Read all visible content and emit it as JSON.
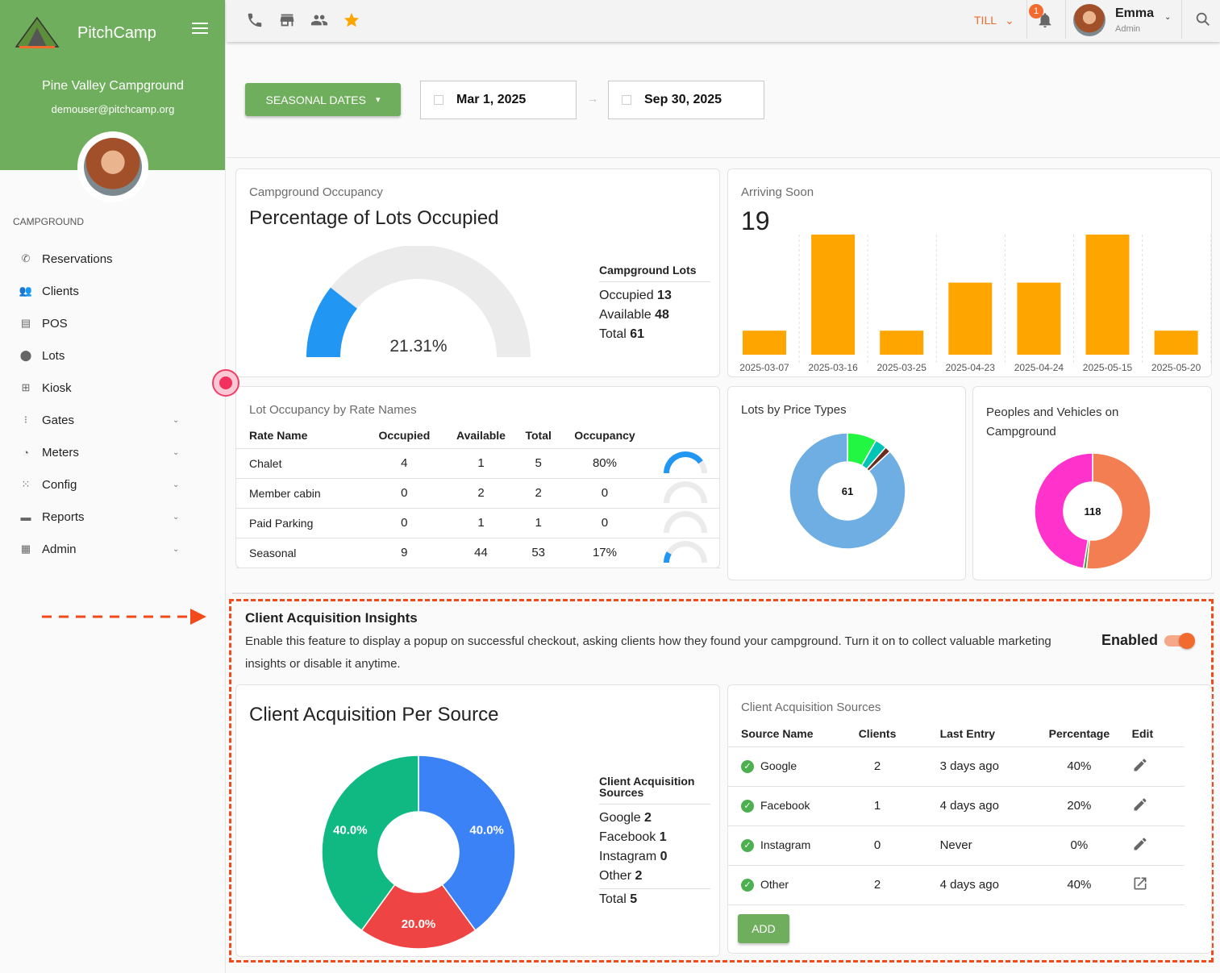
{
  "sidebar": {
    "brand": "PitchCamp",
    "campground_name": "Pine Valley Campground",
    "email": "demouser@pitchcamp.org",
    "section_label": "CAMPGROUND",
    "items": [
      {
        "label": "Reservations",
        "icon": "phone-icon",
        "expandable": false
      },
      {
        "label": "Clients",
        "icon": "people-icon",
        "expandable": false
      },
      {
        "label": "POS",
        "icon": "store-icon",
        "expandable": false
      },
      {
        "label": "Lots",
        "icon": "location-pin-icon",
        "expandable": false
      },
      {
        "label": "Kiosk",
        "icon": "kiosk-screen-icon",
        "expandable": false
      },
      {
        "label": "Gates",
        "icon": "traffic-light-icon",
        "expandable": true
      },
      {
        "label": "Meters",
        "icon": "meter-icon",
        "expandable": true
      },
      {
        "label": "Config",
        "icon": "grid-icon",
        "expandable": true
      },
      {
        "label": "Reports",
        "icon": "printer-icon",
        "expandable": true
      },
      {
        "label": "Admin",
        "icon": "dashboard-icon",
        "expandable": true
      }
    ]
  },
  "topbar": {
    "quick_icons": [
      "phone-icon",
      "store-icon",
      "people-icon",
      "star-icon"
    ],
    "till_label": "TILL",
    "notification_count": "1",
    "user_name": "Emma",
    "user_role": "Admin"
  },
  "filters": {
    "seasonal_label": "SEASONAL DATES",
    "start_date": "Mar 1, 2025",
    "end_date": "Sep 30, 2025",
    "arrow": "→"
  },
  "occupancy": {
    "subtitle": "Campground Occupancy",
    "title": "Percentage of Lots Occupied",
    "percent_label": "21.31%",
    "percent_value": 21.31,
    "legend_title": "Campground Lots",
    "rows": [
      {
        "label": "Occupied",
        "value": "13"
      },
      {
        "label": "Available",
        "value": "48"
      },
      {
        "label": "Total",
        "value": "61"
      }
    ],
    "colors": {
      "fill": "#2196f3",
      "track": "#ebebeb"
    }
  },
  "arriving": {
    "subtitle": "Arriving Soon",
    "total": "19"
  },
  "rate_table": {
    "subtitle": "Lot Occupancy by Rate Names",
    "headers": [
      "Rate Name",
      "Occupied",
      "Available",
      "Total",
      "Occupancy"
    ],
    "rows": [
      {
        "name": "Chalet",
        "occupied": "4",
        "available": "1",
        "total": "5",
        "occupancy": "80%",
        "fraction": 0.8
      },
      {
        "name": "Member cabin",
        "occupied": "0",
        "available": "2",
        "total": "2",
        "occupancy": "0",
        "fraction": 0
      },
      {
        "name": "Paid Parking",
        "occupied": "0",
        "available": "1",
        "total": "1",
        "occupancy": "0",
        "fraction": 0
      },
      {
        "name": "Seasonal",
        "occupied": "9",
        "available": "44",
        "total": "53",
        "occupancy": "17%",
        "fraction": 0.17
      }
    ]
  },
  "price_types": {
    "title": "Lots by Price Types",
    "center_label": "61"
  },
  "people_vehicles": {
    "title": "Peoples and Vehicles on Campground",
    "center_label": "118"
  },
  "insights": {
    "title": "Client Acquisition Insights",
    "description": "Enable this feature to display a popup on successful checkout, asking clients how they found your campground. Turn it on to collect valuable marketing insights or disable it anytime.",
    "enabled_label": "Enabled",
    "enabled": true
  },
  "acq_chart": {
    "title": "Client Acquisition Per Source",
    "legend_title": "Client Acquisition Sources",
    "legend_rows": [
      {
        "label": "Google",
        "value": "2"
      },
      {
        "label": "Facebook",
        "value": "1"
      },
      {
        "label": "Instagram",
        "value": "0"
      },
      {
        "label": "Other",
        "value": "2"
      }
    ],
    "total_label": "Total",
    "total_value": "5"
  },
  "sources_table": {
    "subtitle": "Client Acquisition Sources",
    "headers": [
      "Source Name",
      "Clients",
      "Last Entry",
      "Percentage",
      "Edit"
    ],
    "rows": [
      {
        "name": "Google",
        "clients": "2",
        "last_entry": "3 days ago",
        "percentage": "40%",
        "action_icon": "pencil-icon"
      },
      {
        "name": "Facebook",
        "clients": "1",
        "last_entry": "4 days ago",
        "percentage": "20%",
        "action_icon": "pencil-icon"
      },
      {
        "name": "Instagram",
        "clients": "0",
        "last_entry": "Never",
        "percentage": "0%",
        "action_icon": "pencil-icon"
      },
      {
        "name": "Other",
        "clients": "2",
        "last_entry": "4 days ago",
        "percentage": "40%",
        "action_icon": "open-external-icon"
      }
    ],
    "add_label": "ADD"
  },
  "chart_data": [
    {
      "type": "bar",
      "title": "Arriving Soon",
      "categories": [
        "2025-03-07",
        "2025-03-16",
        "2025-03-25",
        "2025-04-23",
        "2025-04-24",
        "2025-05-15",
        "2025-05-20"
      ],
      "values": [
        1,
        5,
        1,
        3,
        3,
        5,
        1
      ],
      "ylim": [
        0,
        5
      ],
      "color": "#ffa500",
      "grid": "vertical-dashed"
    },
    {
      "type": "pie",
      "title": "Lots by Price Types",
      "donut": true,
      "center_label": "61",
      "values": [
        5,
        2,
        1,
        53
      ],
      "colors": [
        "#22f542",
        "#00c4b4",
        "#6b2d1f",
        "#6faee3"
      ]
    },
    {
      "type": "pie",
      "title": "Peoples and Vehicles on Campground",
      "donut": true,
      "center_label": "118",
      "values": [
        61,
        1,
        56
      ],
      "colors": [
        "#f27e52",
        "#3c9a3c",
        "#ff33cc"
      ]
    },
    {
      "type": "pie",
      "title": "Client Acquisition Per Source",
      "donut": true,
      "categories": [
        "Google",
        "Facebook",
        "Instagram",
        "Other"
      ],
      "values": [
        2,
        1,
        0,
        2
      ],
      "labels": [
        "40.0%",
        "20.0%",
        "",
        "40.0%"
      ],
      "colors": [
        "#3b82f6",
        "#ef4444",
        "#f59e0b",
        "#10b981"
      ]
    }
  ]
}
